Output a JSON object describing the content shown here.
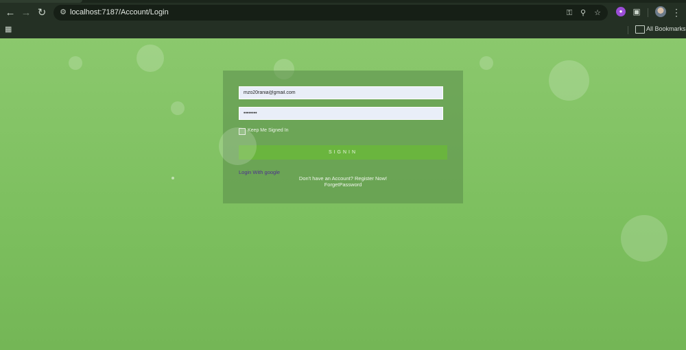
{
  "browser": {
    "url": "localhost:7187/Account/Login",
    "bookmarks_label": "All Bookmarks",
    "icons": {
      "back": "back-arrow-icon",
      "forward": "forward-arrow-icon",
      "reload": "reload-icon",
      "site_info": "site-info-icon",
      "key": "key-icon",
      "zoom": "zoom-icon",
      "star": "star-icon",
      "extensions": "puzzle-icon",
      "menu": "menu-dots-icon",
      "apps": "apps-grid-icon",
      "folder": "folder-icon"
    }
  },
  "login": {
    "email_value": "mzo20rania@gmail.com",
    "password_value": "••••••••",
    "keep_signed_in_label": "Keep Me Signed In",
    "signin_label": "SIGNIN",
    "google_label": "Login With google",
    "register_text": "Don't have an Account? Register Now!",
    "forget_label": "ForgetPassword"
  },
  "colors": {
    "page_bg": "#7cbc5e",
    "card_bg": "#5a8c4b",
    "button_bg": "#6ab53e",
    "google_link": "#4d2f8f"
  }
}
